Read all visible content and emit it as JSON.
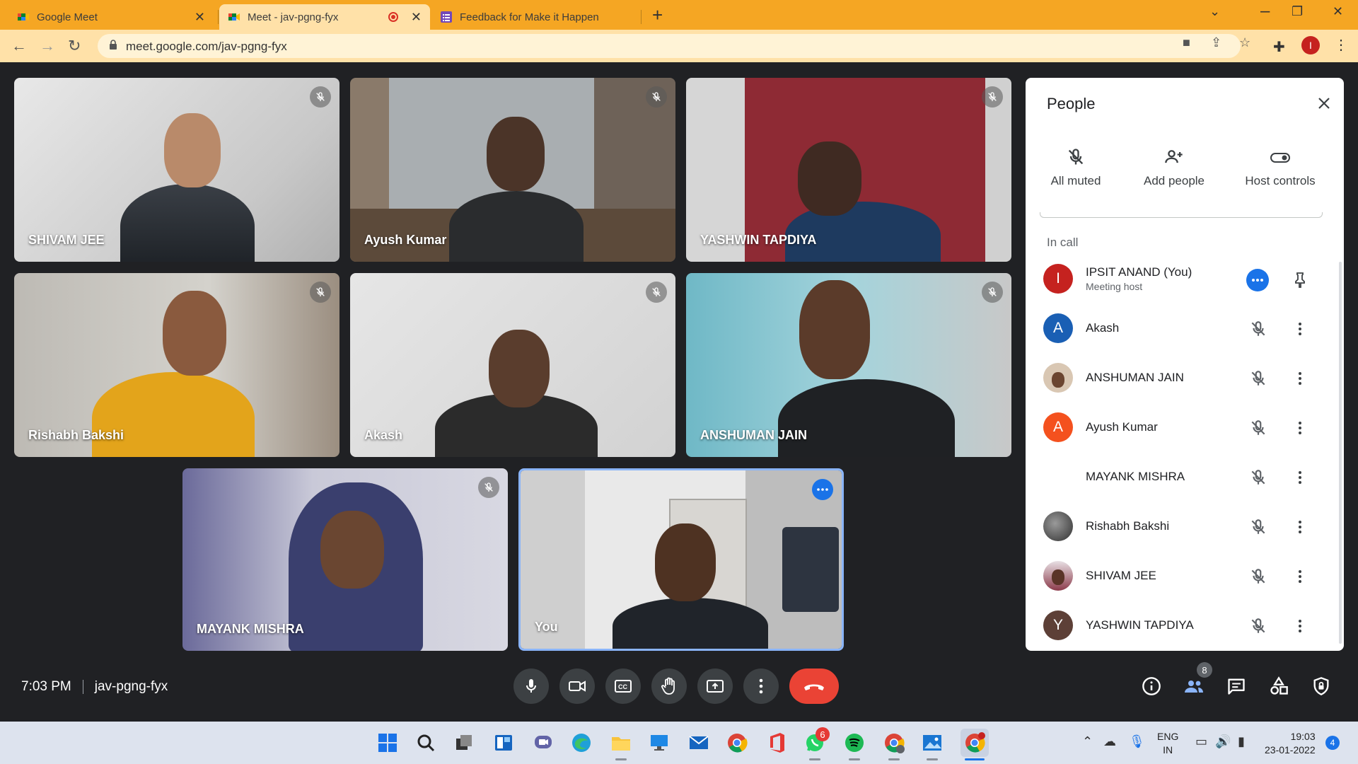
{
  "browser": {
    "tabs": [
      {
        "title": "Google Meet",
        "active": false
      },
      {
        "title": "Meet - jav-pgng-fyx",
        "active": true
      },
      {
        "title": "Feedback for Make it Happen",
        "active": false
      }
    ],
    "url": "meet.google.com/jav-pgng-fyx",
    "profile_initial": "I"
  },
  "tiles": [
    {
      "name": "SHIVAM JEE"
    },
    {
      "name": "Ayush Kumar"
    },
    {
      "name": "YASHWIN TAPDIYA"
    },
    {
      "name": "Rishabh Bakshi"
    },
    {
      "name": "Akash"
    },
    {
      "name": "ANSHUMAN JAIN"
    },
    {
      "name": "MAYANK MISHRA"
    },
    {
      "name": "You"
    }
  ],
  "people_panel": {
    "title": "People",
    "actions": {
      "all_muted": "All muted",
      "add_people": "Add people",
      "host_controls": "Host controls"
    },
    "section_label": "In call",
    "participants": [
      {
        "name": "IPSIT ANAND (You)",
        "subtitle": "Meeting host",
        "initial": "I",
        "color": "#c5221f"
      },
      {
        "name": "Akash",
        "initial": "A",
        "color": "#1a5fb4"
      },
      {
        "name": "ANSHUMAN JAIN",
        "initial": "",
        "color": "#b9a48e"
      },
      {
        "name": "Ayush Kumar",
        "initial": "A",
        "color": "#f4511e"
      },
      {
        "name": "MAYANK MISHRA",
        "initial": "",
        "color": "#ffffff"
      },
      {
        "name": "Rishabh Bakshi",
        "initial": "",
        "color": "#4a4a4a"
      },
      {
        "name": "SHIVAM JEE",
        "initial": "",
        "color": "#8b5a5a"
      },
      {
        "name": "YASHWIN TAPDIYA",
        "initial": "Y",
        "color": "#5d4037"
      }
    ]
  },
  "meeting": {
    "time": "7:03 PM",
    "code": "jav-pgng-fyx",
    "people_count": "8"
  },
  "taskbar": {
    "lang_top": "ENG",
    "lang_bottom": "IN",
    "clock_time": "19:03",
    "clock_date": "23-01-2022",
    "whatsapp_badge": "6",
    "notification_count": "4"
  }
}
